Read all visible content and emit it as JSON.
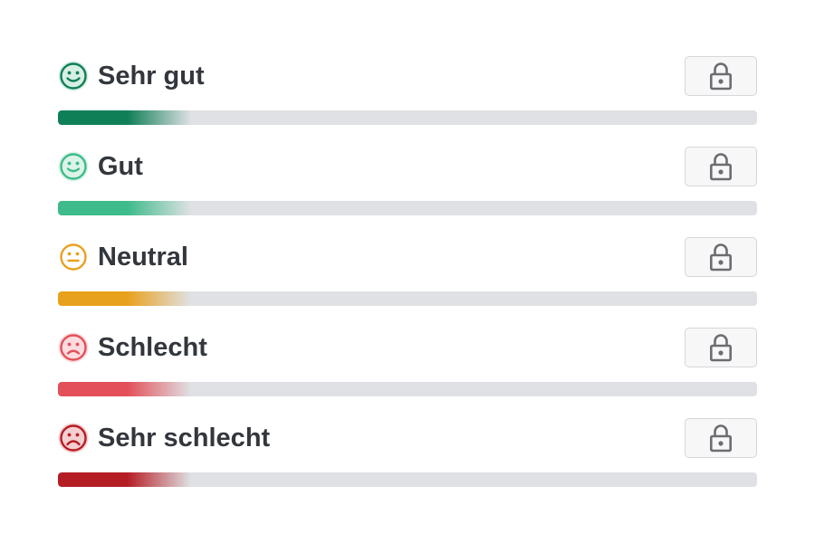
{
  "ratings": [
    {
      "label": "Sehr gut",
      "icon": "very-happy-face-icon",
      "color": "#0f7f57",
      "face_bg": "#d8efe4",
      "mood": "very-happy",
      "fill": 0.19
    },
    {
      "label": "Gut",
      "icon": "happy-face-icon",
      "color": "#3dbb8a",
      "face_bg": "#dcf3e9",
      "mood": "happy",
      "fill": 0.19
    },
    {
      "label": "Neutral",
      "icon": "neutral-face-icon",
      "color": "#e8a11c",
      "face_bg": "#fdf0d6",
      "mood": "neutral",
      "fill": 0.19
    },
    {
      "label": "Schlecht",
      "icon": "sad-face-icon",
      "color": "#e3505a",
      "face_bg": "#fbdcdf",
      "mood": "sad",
      "fill": 0.19
    },
    {
      "label": "Sehr schlecht",
      "icon": "very-sad-face-icon",
      "color": "#b51d25",
      "face_bg": "#f4cfd1",
      "mood": "very-sad",
      "fill": 0.19
    }
  ],
  "lock_icon": "lock-icon"
}
